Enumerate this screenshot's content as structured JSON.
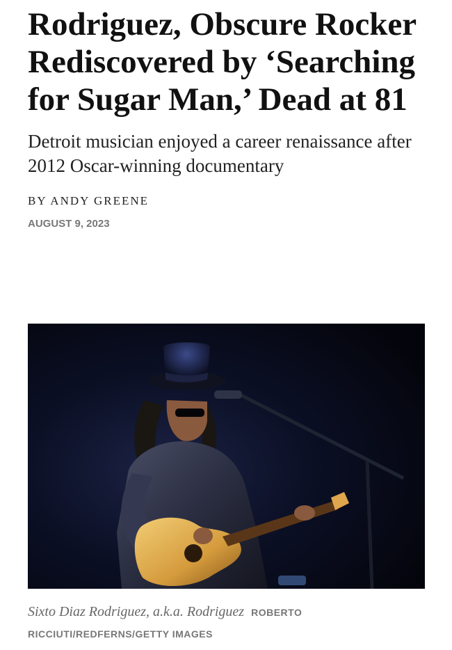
{
  "article": {
    "headline": "Rodriguez, Obscure Rocker Rediscovered by ‘Searching for Sugar Man,’ Dead at 81",
    "dek": "Detroit musician enjoyed a career renaissance after 2012 Oscar-winning documentary",
    "byline": "BY ANDY GREENE",
    "date": "AUGUST 9, 2023"
  },
  "image": {
    "caption": "Sixto Diaz Rodriguez, a.k.a. Rodriguez",
    "credit": "ROBERTO RICCIUTI/REDFERNS/GETTY IMAGES"
  }
}
